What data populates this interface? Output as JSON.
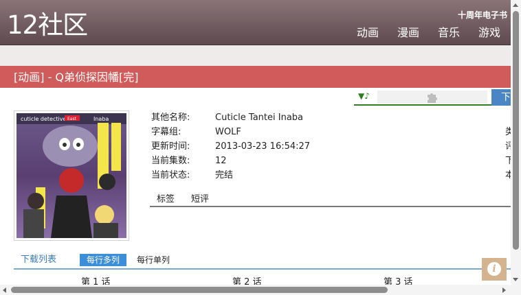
{
  "header": {
    "logo": "12社区",
    "tagline": "十周年电子书",
    "nav": [
      "动画",
      "漫画",
      "音乐",
      "游戏"
    ]
  },
  "title": "[动画] - Q弟侦探因幡[完]",
  "player": {
    "arrow_label": "▼♪",
    "download_label": "下"
  },
  "cover": {
    "text_left": "cuticle detective",
    "text_right": "Inaba",
    "badge": "East"
  },
  "info": [
    {
      "label": "其他名称:",
      "value": "Cuticle Tantei Inaba"
    },
    {
      "label": "字幕组:",
      "value": "WOLF"
    },
    {
      "label": "更新时间:",
      "value": "2013-03-23 16:54:27"
    },
    {
      "label": "当前集数:",
      "value": "12"
    },
    {
      "label": "当前状态:",
      "value": "完结"
    }
  ],
  "info_right": [
    "类",
    "评",
    "下",
    "本"
  ],
  "subtabs": [
    "标签",
    "短评"
  ],
  "download_list": {
    "title": "下载列表",
    "mode_active": "每行多列",
    "mode_other": "每行单列",
    "episodes": [
      "第 1 话",
      "第 2 话",
      "第 3 话"
    ]
  },
  "info_button": "i",
  "colors": {
    "header_top": "#8a7478",
    "header_bottom": "#5e4a4f",
    "title_bar": "#cf5b5b",
    "accent_blue": "#4a86c4",
    "player_green": "#2e7d1f",
    "info_button": "#d4b48f"
  },
  "icons": {
    "plugin": "puzzle-piece-icon",
    "info": "info-icon"
  }
}
